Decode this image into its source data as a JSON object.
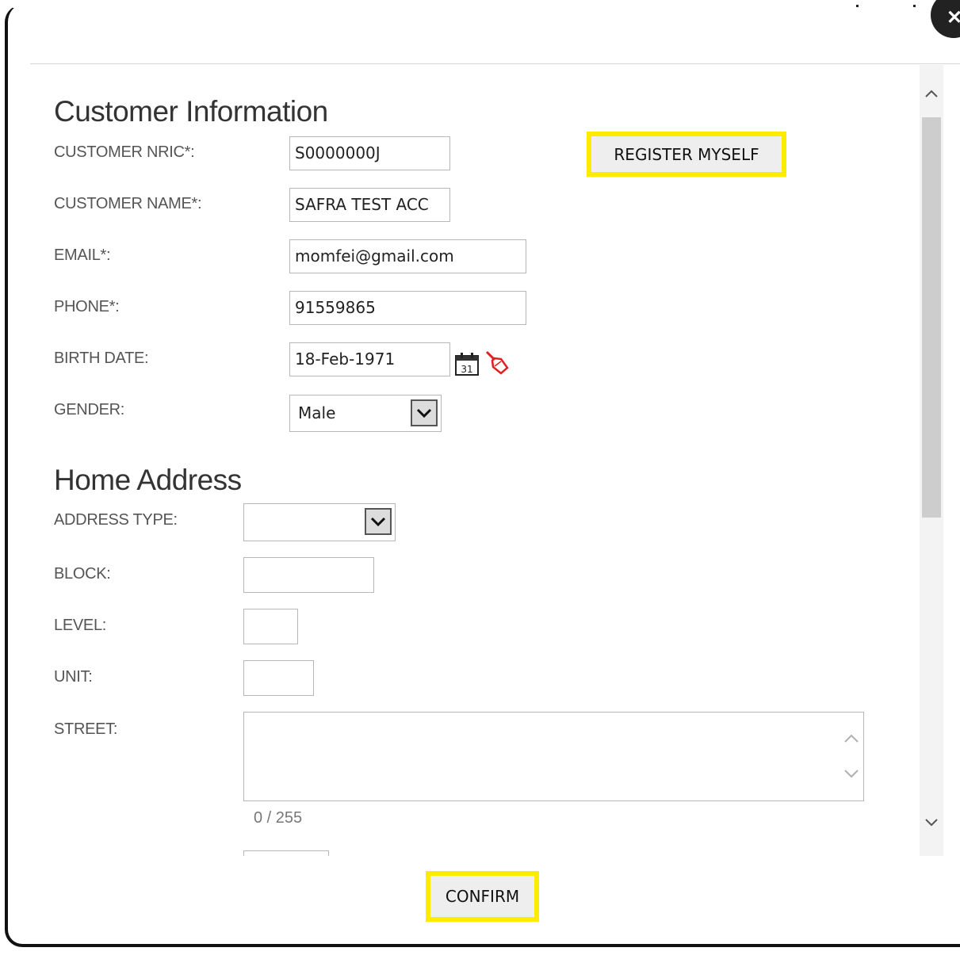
{
  "customer_info": {
    "title": "Customer Information",
    "nric_label": "CUSTOMER NRIC*:",
    "nric_value": "S0000000J",
    "name_label": "CUSTOMER NAME*:",
    "name_value": "SAFRA TEST ACC",
    "email_label": "EMAIL*:",
    "email_value": "momfei@gmail.com",
    "phone_label": "PHONE*:",
    "phone_value": "91559865",
    "birth_label": "BIRTH DATE:",
    "birth_value": "18-Feb-1971",
    "calendar_day": "31",
    "gender_label": "GENDER:",
    "gender_value": "Male",
    "register_button": "REGISTER MYSELF"
  },
  "home_address": {
    "title": "Home Address",
    "address_type_label": "ADDRESS TYPE:",
    "address_type_value": "",
    "block_label": "BLOCK:",
    "level_label": "LEVEL:",
    "unit_label": "UNIT:",
    "street_label": "STREET:",
    "street_counter": "0 / 255"
  },
  "footer": {
    "confirm_button": "CONFIRM"
  },
  "colors": {
    "highlight": "#ffea00",
    "eraser": "#e02020"
  }
}
